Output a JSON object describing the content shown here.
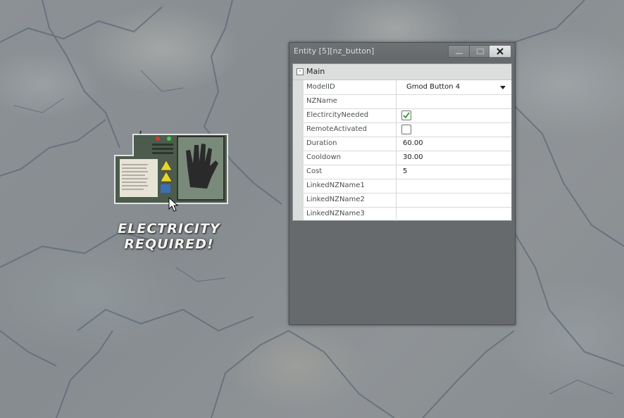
{
  "window": {
    "title": "Entity [5][nz_button]",
    "category": "Main",
    "category_toggle": "-",
    "controls": [
      "minimize-icon",
      "maximize-icon",
      "close-icon"
    ]
  },
  "properties": [
    {
      "key": "ModelID",
      "value": "Gmod Button 4",
      "type": "combo"
    },
    {
      "key": "NZName",
      "value": "",
      "type": "text"
    },
    {
      "key": "ElectircityNeeded",
      "value": "",
      "type": "checkbox",
      "checked": true
    },
    {
      "key": "RemoteActivated",
      "value": "",
      "type": "checkbox",
      "checked": false
    },
    {
      "key": "Duration",
      "value": "60.00",
      "type": "number"
    },
    {
      "key": "Cooldown",
      "value": "30.00",
      "type": "number"
    },
    {
      "key": "Cost",
      "value": "5",
      "type": "number"
    },
    {
      "key": "LinkedNZName1",
      "value": "",
      "type": "text"
    },
    {
      "key": "LinkedNZName2",
      "value": "",
      "type": "text"
    },
    {
      "key": "LinkedNZName3",
      "value": "",
      "type": "text"
    }
  ],
  "world": {
    "prop_label": "ELECTRICITY REQUIRED!"
  },
  "colors": {
    "window_bg": "#666a6c",
    "checkbox_check": "#3aa33a"
  }
}
